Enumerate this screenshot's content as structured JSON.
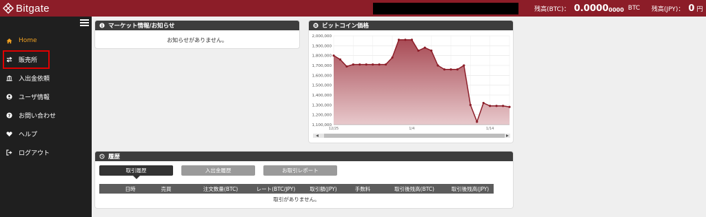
{
  "header": {
    "logo_text": "Bitgate",
    "balance_btc_label": "残高(BTC)：",
    "balance_btc_value": "0.0000",
    "balance_btc_small": "0000",
    "balance_btc_unit": "BTC",
    "balance_jpy_label": "残高(JPY)：",
    "balance_jpy_value": "0",
    "balance_jpy_unit": "円"
  },
  "sidebar": {
    "items": [
      {
        "label": "Home",
        "icon": "home-icon"
      },
      {
        "label": "販売所",
        "icon": "exchange-icon"
      },
      {
        "label": "入出金依頼",
        "icon": "bank-icon"
      },
      {
        "label": "ユーザ情報",
        "icon": "user-icon"
      },
      {
        "label": "お問い合わせ",
        "icon": "question-icon"
      },
      {
        "label": "ヘルプ",
        "icon": "heart-icon"
      },
      {
        "label": "ログアウト",
        "icon": "logout-icon"
      }
    ]
  },
  "news": {
    "title": "マーケット情報/お知らせ",
    "empty": "お知らせがありません。"
  },
  "price_chart": {
    "title": "ビットコイン価格"
  },
  "chart_data": {
    "type": "area",
    "title": "ビットコイン価格",
    "ylim": [
      1100000,
      2000000
    ],
    "yticks": [
      "2,000,000",
      "1,900,000",
      "1,800,000",
      "1,700,000",
      "1,600,000",
      "1,500,000",
      "1,400,000",
      "1,300,000",
      "1,200,000",
      "1,100,000"
    ],
    "xticks": [
      "12/25",
      "1/4",
      "1/14"
    ],
    "grid": true,
    "series": [
      {
        "values": [
          1800000,
          1760000,
          1690000,
          1710000,
          1710000,
          1710000,
          1710000,
          1710000,
          1710000,
          1780000,
          1960000,
          1960000,
          1960000,
          1850000,
          1880000,
          1850000,
          1700000,
          1660000,
          1660000,
          1660000,
          1700000,
          1300000,
          1130000,
          1320000,
          1290000,
          1290000,
          1290000,
          1280000
        ]
      }
    ],
    "colors": {
      "line": "#8c1d28",
      "fill_top": "#a84b55",
      "fill_bottom": "#e8c9cc"
    }
  },
  "history": {
    "title": "履歴",
    "tabs": [
      "取引履歴",
      "入出金履歴",
      "お取引レポート"
    ],
    "columns": [
      "日時",
      "売買",
      "注文数量(BTC)",
      "レート(BTC/JPY)",
      "取引額(JPY)",
      "手数料",
      "取引後残高(BTC)",
      "取引後残高(JPY)"
    ],
    "empty": "取引がありません。"
  },
  "colors": {
    "brand": "#8c1d28",
    "active_nav": "#f0a020",
    "highlight": "#e00000"
  }
}
